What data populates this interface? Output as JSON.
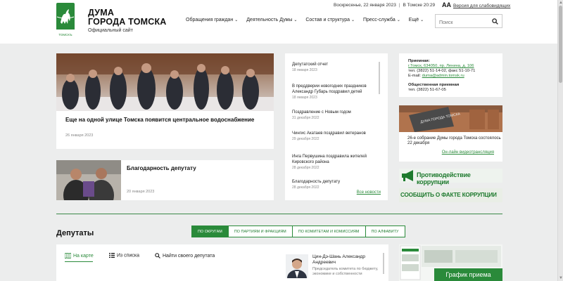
{
  "header": {
    "title_line1": "ДУМА",
    "title_line2": "ГОРОДА ТОМСКА",
    "subtitle": "Официальный сайт",
    "logo_caption": "ТОМСКЪ",
    "date_text": "Воскресенье, 22 января 2023",
    "time_text": "В Томске 20:29",
    "a11y_icon_text": "AA",
    "a11y_link": "Версия для слабовидящих",
    "nav": [
      {
        "label": "Обращения граждан"
      },
      {
        "label": "Деятельность Думы"
      },
      {
        "label": "Состав и структура"
      },
      {
        "label": "Пресс-служба"
      },
      {
        "label": "Ещё"
      }
    ],
    "search_placeholder": "Поиск"
  },
  "main_news": {
    "title": "Еще на одной улице Томска появится центральное водоснабжение",
    "date": "26 января 2023"
  },
  "second_news": {
    "title": "Благодарность депутату",
    "date": "20 января 2023"
  },
  "news_list": {
    "items": [
      {
        "title": "Депутатский отчет",
        "date": "18 января 2023"
      },
      {
        "title": "В преддверии новогодних праздников Александр Губарь поздравил детей",
        "date": "18 января 2023"
      },
      {
        "title": "Поздравление с Новым годом",
        "date": "31 декабря 2022"
      },
      {
        "title": "Чингис Акатаев поздравил ветеранов",
        "date": "29 декабря 2022"
      },
      {
        "title": "Инга Первушина поздравила жителей Кировского района",
        "date": "28 декабря 2022"
      },
      {
        "title": "Благодарность депутату",
        "date": "28 декабря 2022"
      }
    ],
    "all_link": "Все новости"
  },
  "contacts": {
    "reception_label": "Приемная:",
    "address": "г.Томск, 634050, пр. Ленина, д. 106",
    "phone": "тел. (3822) 51-14-02, факс 51-10-71",
    "email_label": "E-mail:",
    "email": "duma@admin.tomsk.ru",
    "public_label": "Общественная приемная",
    "public_phone": "тел. (3822) 51-67-05"
  },
  "duma_card": {
    "sign_text": "ДУМА ГОРОДА ТОМСКА",
    "text": "26-е собрание Думы города Томска состоялось 22 декабря",
    "link": "Он-лайн видеотрансляция"
  },
  "banners": {
    "corruption": "Противодействие коррупции",
    "report": "СООБЩИТЬ О ФАКТЕ КОРРУПЦИИ"
  },
  "deputies": {
    "title": "Депутаты",
    "tabs": [
      {
        "label": "ПО ОКРУГАМ",
        "active": true
      },
      {
        "label": "ПО ПАРТИЯМ И ФРАКЦИЯМ",
        "active": false
      },
      {
        "label": "ПО КОМИТЕТАМ И КОМИССИЯМ",
        "active": false
      },
      {
        "label": "ПО АЛФАВИТУ",
        "active": false
      }
    ],
    "view_map": "На карте",
    "view_list": "Из списка",
    "find_label": "Найти своего депутата",
    "person_name": "Цин-Дэ-Шань Александр Андреевич",
    "person_role": "Председатель комитета по бюджету, экономике и собственности"
  },
  "schedule_button": "График приема",
  "colors": {
    "accent": "#2a8a3a",
    "background": "#eceded"
  }
}
